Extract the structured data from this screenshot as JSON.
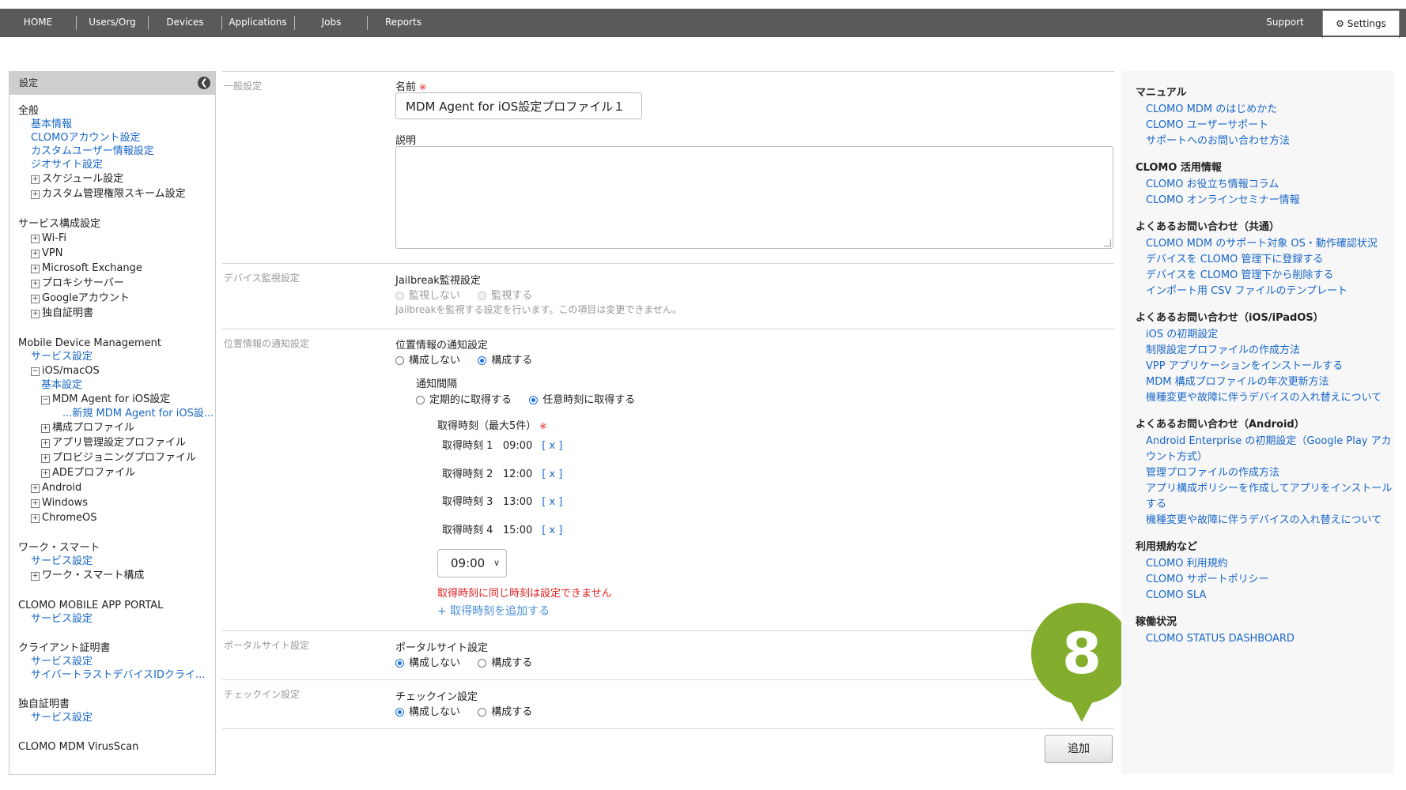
{
  "nav": {
    "items": [
      "HOME",
      "Users/Org",
      "Devices",
      "Applications",
      "Jobs",
      "Reports"
    ],
    "support": "Support",
    "settings": "Settings"
  },
  "sidebar": {
    "header": "設定",
    "general": {
      "title": "全般",
      "links": [
        "基本情報",
        "CLOMOアカウント設定",
        "カスタムユーザー情報設定",
        "ジオサイト設定"
      ],
      "expandables": [
        "スケジュール設定",
        "カスタム管理権限スキーム設定"
      ]
    },
    "service": {
      "title": "サービス構成設定",
      "items": [
        "Wi-Fi",
        "VPN",
        "Microsoft Exchange",
        "プロキシサーバー",
        "Googleアカウント",
        "独自証明書"
      ]
    },
    "mdm": {
      "title": "Mobile Device Management",
      "service_link": "サービス設定",
      "ios_macos": "iOS/macOS",
      "basic_link": "基本設定",
      "agent_settings": "MDM Agent for iOS設定",
      "new_agent_link": "...新規 MDM Agent for iOS設...",
      "sub_items": [
        "構成プロファイル",
        "アプリ管理設定プロファイル",
        "プロビジョニングプロファイル",
        "ADEプロファイル"
      ],
      "platforms": [
        "Android",
        "Windows",
        "ChromeOS"
      ]
    },
    "work_smart": {
      "title": "ワーク・スマート",
      "link": "サービス設定",
      "item": "ワーク・スマート構成"
    },
    "portal": {
      "title": "CLOMO MOBILE APP PORTAL",
      "link": "サービス設定"
    },
    "client_cert": {
      "title": "クライアント証明書",
      "links": [
        "サービス設定",
        "サイバートラストデバイスIDクライ..."
      ]
    },
    "own_cert": {
      "title": "独自証明書",
      "link": "サービス設定"
    },
    "virusscan": {
      "title": "CLOMO MDM VirusScan"
    }
  },
  "main": {
    "general": {
      "section": "一般設定",
      "name_label": "名前",
      "required_mark": "※",
      "name_value": "MDM Agent for iOS設定プロファイル１",
      "desc_label": "説明"
    },
    "device_monitor": {
      "section": "デバイス監視設定",
      "label": "Jailbreak監視設定",
      "opt_no": "監視しない",
      "opt_yes": "監視する",
      "note": "Jailbreakを監視する設定を行います。この項目は変更できません。"
    },
    "location": {
      "section": "位置情報の通知設定",
      "label": "位置情報の通知設定",
      "opt_no": "構成しない",
      "opt_yes": "構成する",
      "interval_label": "通知間隔",
      "interval_periodic": "定期的に取得する",
      "interval_any": "任意時刻に取得する",
      "times_label": "取得時刻（最大5件）",
      "times": [
        {
          "label": "取得時刻 1",
          "time": "09:00",
          "remove": "[ x ]"
        },
        {
          "label": "取得時刻 2",
          "time": "12:00",
          "remove": "[ x ]"
        },
        {
          "label": "取得時刻 3",
          "time": "13:00",
          "remove": "[ x ]"
        },
        {
          "label": "取得時刻 4",
          "time": "15:00",
          "remove": "[ x ]"
        }
      ],
      "select_value": "09:00",
      "error": "取得時刻に同じ時刻は設定できません",
      "add_time": "+ 取得時刻を追加する"
    },
    "portal": {
      "section": "ポータルサイト設定",
      "label": "ポータルサイト設定",
      "opt_no": "構成しない",
      "opt_yes": "構成する"
    },
    "checkin": {
      "section": "チェックイン設定",
      "label": "チェックイン設定",
      "opt_no": "構成しない",
      "opt_yes": "構成する"
    },
    "add_button": "追加",
    "badge": "8"
  },
  "rpanel": {
    "sections": [
      {
        "title": "マニュアル",
        "links": [
          "CLOMO MDM のはじめかた",
          "CLOMO ユーザーサポート",
          "サポートへのお問い合わせ方法"
        ]
      },
      {
        "title": "CLOMO 活用情報",
        "links": [
          "CLOMO お役立ち情報コラム",
          "CLOMO オンラインセミナー情報"
        ]
      },
      {
        "title": "よくあるお問い合わせ（共通）",
        "links": [
          "CLOMO MDM のサポート対象 OS・動作確認状況",
          "デバイスを CLOMO 管理下に登録する",
          "デバイスを CLOMO 管理下から削除する",
          "インポート用 CSV ファイルのテンプレート"
        ]
      },
      {
        "title": "よくあるお問い合わせ（iOS/iPadOS）",
        "links": [
          "iOS の初期設定",
          "制限設定プロファイルの作成方法",
          "VPP アプリケーションをインストールする",
          "MDM 構成プロファイルの年次更新方法",
          "機種変更や故障に伴うデバイスの入れ替えについて"
        ]
      },
      {
        "title": "よくあるお問い合わせ（Android）",
        "links": [
          "Android Enterprise の初期設定（Google Play アカウント方式）",
          "管理プロファイルの作成方法",
          "アプリ構成ポリシーを作成してアプリをインストールする",
          "機種変更や故障に伴うデバイスの入れ替えについて"
        ]
      },
      {
        "title": "利用規約など",
        "links": [
          "CLOMO 利用規約",
          "CLOMO サポートポリシー",
          "CLOMO SLA"
        ]
      },
      {
        "title": "稼働状況",
        "links": [
          "CLOMO STATUS DASHBOARD"
        ]
      }
    ]
  },
  "colors": {
    "accent": "#1766c8",
    "badge": "#83ad2c",
    "error": "#e02020",
    "nav": "#5a5a5a"
  }
}
